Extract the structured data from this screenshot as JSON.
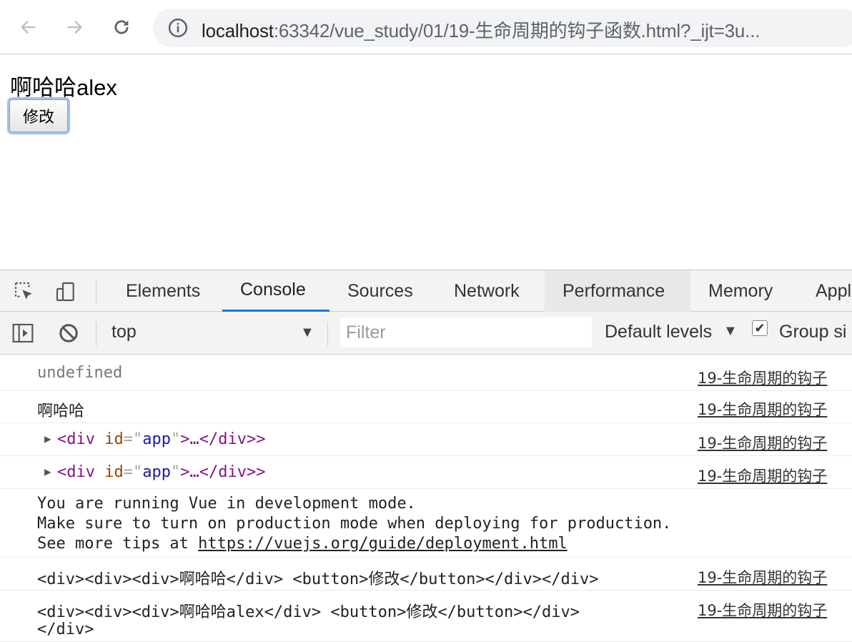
{
  "browser": {
    "url_host": "localhost",
    "url_rest": ":63342/vue_study/01/19-生命周期的钩子函数.html?_ijt=3u..."
  },
  "page": {
    "message": "啊哈哈alex",
    "button_label": "修改"
  },
  "devtools": {
    "tabs": [
      "Elements",
      "Console",
      "Sources",
      "Network",
      "Performance",
      "Memory",
      "Appl"
    ],
    "active_tab": "Console",
    "context": "top",
    "filter_placeholder": "Filter",
    "levels": "Default levels",
    "group_label": "Group si"
  },
  "console": {
    "source": "19-生命周期的钩子",
    "messages": [
      {
        "text": "undefined"
      },
      {
        "text": "啊哈哈"
      },
      {
        "tag_open": "<div",
        "attr": "id",
        "value": "app",
        "ellipsis": ">…</div>",
        "tag_close": ">"
      },
      {
        "tag_open": "<div",
        "attr": "id",
        "value": "app",
        "ellipsis": ">…</div>",
        "tag_close": ">"
      },
      {
        "line1": "You are running Vue in development mode.",
        "line2": "Make sure to turn on production mode when deploying for production.",
        "line3_prefix": "See more tips at ",
        "line3_link": "https://vuejs.org/guide/deployment.html"
      },
      {
        "text": "<div><div><div>啊哈哈</div> <button>修改</button></div></div>"
      },
      {
        "line1": "<div><div><div>啊哈哈alex</div> <button>修改</button></div>",
        "line2": "</div>"
      }
    ]
  },
  "colors": {
    "active_tab_underline": "#1a73e8",
    "tag": "#881280",
    "attr": "#994500",
    "value": "#1a1aa6"
  }
}
